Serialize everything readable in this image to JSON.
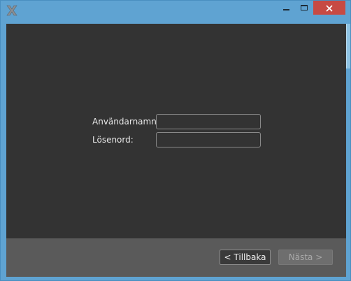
{
  "window": {
    "app_icon": "x-logo-icon",
    "controls": {
      "minimize_icon": "minimize-icon",
      "maximize_icon": "maximize-icon",
      "close_icon": "close-icon"
    },
    "colors": {
      "frame": "#5fa3d2",
      "client": "#333333",
      "footer": "#5a5a5a",
      "close": "#c74a43"
    }
  },
  "login_form": {
    "username_label": "Användarnamn:",
    "username_value": "",
    "password_label": "Lösenord:",
    "password_value": ""
  },
  "footer": {
    "back_label": "< Tillbaka",
    "next_label": "Nästa >",
    "next_enabled": false
  }
}
